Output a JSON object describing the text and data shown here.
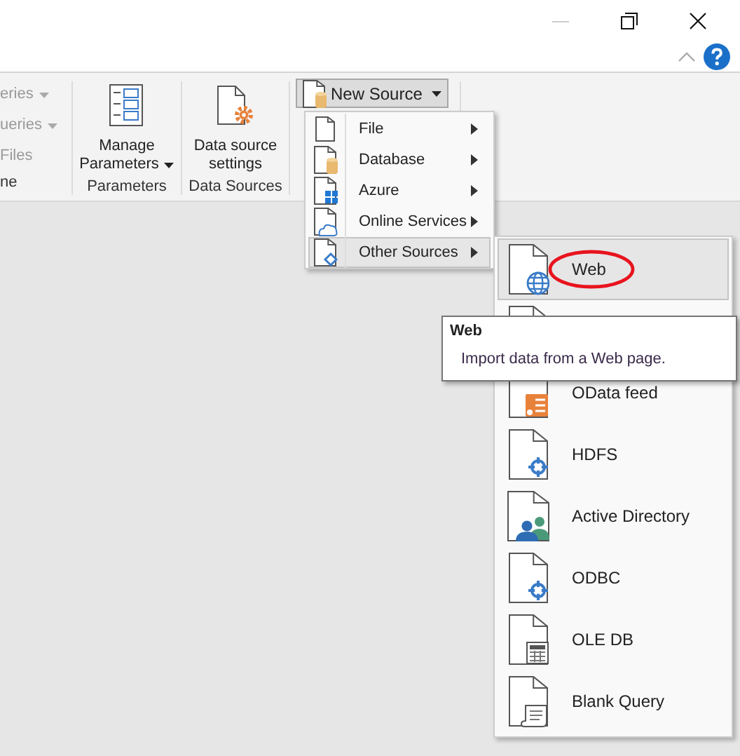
{
  "ribbon": {
    "groups": [
      {
        "kind": "small-list",
        "label": "ne",
        "items": [
          {
            "label": "eries",
            "disabled": true
          },
          {
            "label": "ueries",
            "disabled": true
          },
          {
            "label": "Files",
            "disabled": true
          }
        ]
      },
      {
        "kind": "large-button",
        "label": "Parameters",
        "lines": [
          "Manage",
          "Parameters"
        ],
        "dropdown": true
      },
      {
        "kind": "large-button",
        "label": "Data Sources",
        "lines": [
          "Data source",
          "settings"
        ],
        "dropdown": false
      },
      {
        "kind": "split-button",
        "button": {
          "label": "New Source",
          "pressed": true
        }
      }
    ]
  },
  "menu": {
    "items": [
      {
        "label": "File",
        "selected": false
      },
      {
        "label": "Database",
        "selected": false
      },
      {
        "label": "Azure",
        "selected": false
      },
      {
        "label": "Online Services",
        "selected": false
      },
      {
        "label": "Other Sources",
        "selected": true
      }
    ]
  },
  "submenu": {
    "items": [
      {
        "label": "Web",
        "selected": true
      },
      {
        "selected": false
      },
      {
        "label": "OData feed",
        "selected": false
      },
      {
        "label": "HDFS",
        "selected": false
      },
      {
        "label": "Active Directory",
        "selected": false
      },
      {
        "label": "ODBC",
        "selected": false
      },
      {
        "label": "OLE DB",
        "selected": false
      },
      {
        "label": "Blank Query",
        "selected": false
      }
    ]
  },
  "tooltip": {
    "title": "Web",
    "text": "Import data from a Web page."
  }
}
